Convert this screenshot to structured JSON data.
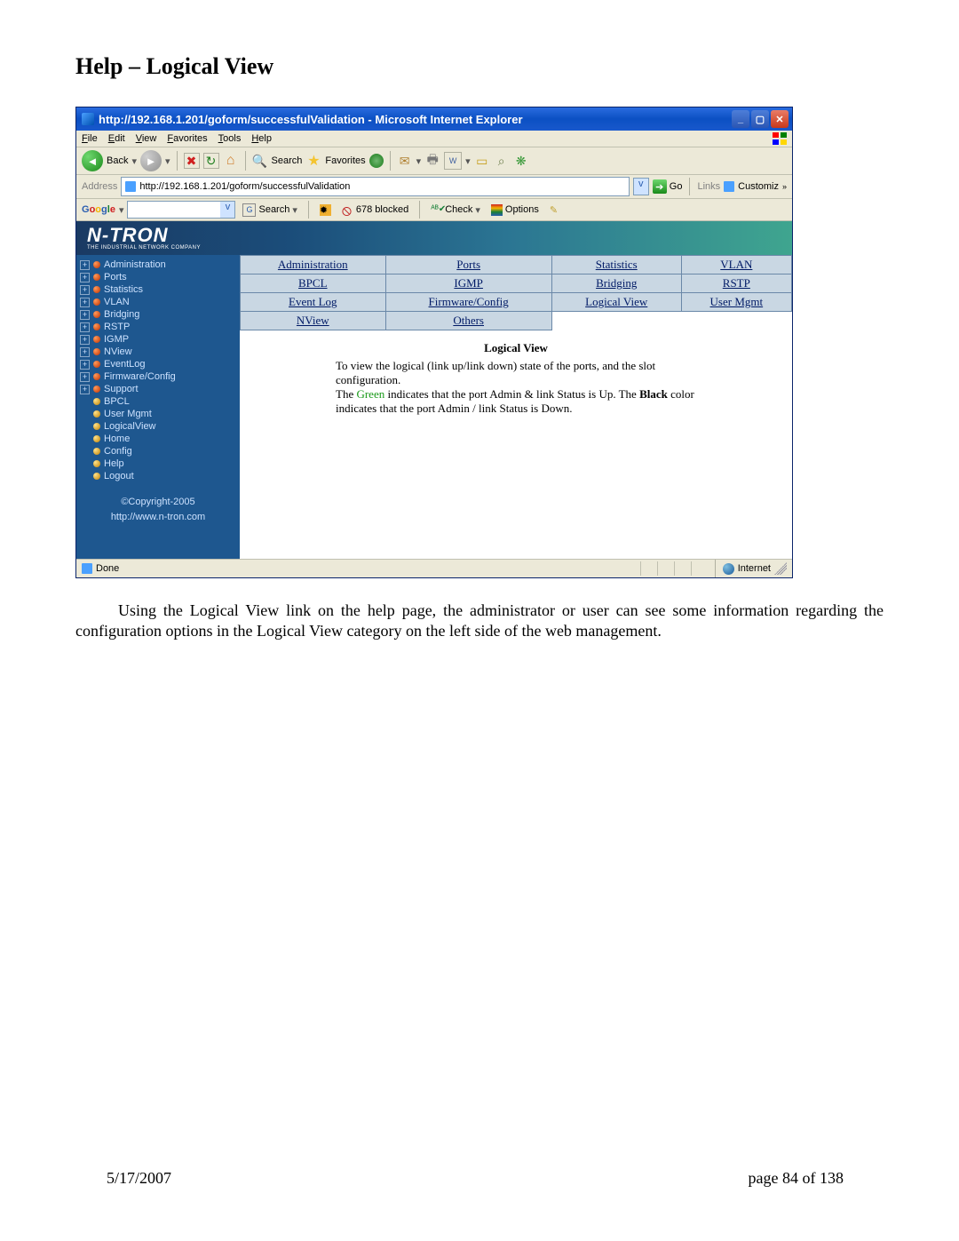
{
  "page": {
    "heading": "Help – Logical View",
    "body_paragraph_1": "Using the Logical View link on the help page, the administrator or user can see some information regarding the configuration options in the Logical View category on the left side of the web management.",
    "footer_date": "5/17/2007",
    "footer_page": "page 84 of 138"
  },
  "browser": {
    "title": "http://192.168.1.201/goform/successfulValidation - Microsoft Internet Explorer",
    "menus": [
      "File",
      "Edit",
      "View",
      "Favorites",
      "Tools",
      "Help"
    ],
    "toolbar": {
      "back": "Back",
      "search": "Search",
      "favorites": "Favorites"
    },
    "address_label": "Address",
    "address_value": "http://192.168.1.201/goform/successfulValidation",
    "go": "Go",
    "links_label": "Links",
    "links_item": "Customiz",
    "google": {
      "search": "Search",
      "blocked": "678 blocked",
      "check": "Check",
      "options": "Options"
    },
    "status_done": "Done",
    "status_zone": "Internet"
  },
  "app": {
    "brand": "N-TRON",
    "brand_sub": "THE INDUSTRIAL NETWORK COMPANY",
    "sidebar": {
      "expandable": [
        "Administration",
        "Ports",
        "Statistics",
        "VLAN",
        "Bridging",
        "RSTP",
        "IGMP",
        "NView",
        "EventLog",
        "Firmware/Config",
        "Support"
      ],
      "plain": [
        "BPCL",
        "User Mgmt",
        "LogicalView",
        "Home",
        "Config",
        "Help",
        "Logout"
      ],
      "copyright": "©Copyright-2005",
      "url": "http://www.n-tron.com"
    },
    "tabs": {
      "row1": [
        "Administration",
        "Ports",
        "Statistics",
        "VLAN"
      ],
      "row2": [
        "BPCL",
        "IGMP",
        "Bridging",
        "RSTP"
      ],
      "row3": [
        "Event Log",
        "Firmware/Config",
        "Logical View",
        "User Mgmt"
      ],
      "row4": [
        "NView",
        "Others"
      ]
    },
    "content": {
      "title": "Logical View",
      "line1": "To view the logical (link up/link down) state of the ports, and the slot configuration.",
      "line2a": "The ",
      "line2_green": "Green",
      "line2b": " indicates that the port Admin & link Status is Up. The ",
      "line2_black": "Black",
      "line2c": " color",
      "line3": "indicates that the port Admin / link Status is Down."
    }
  }
}
